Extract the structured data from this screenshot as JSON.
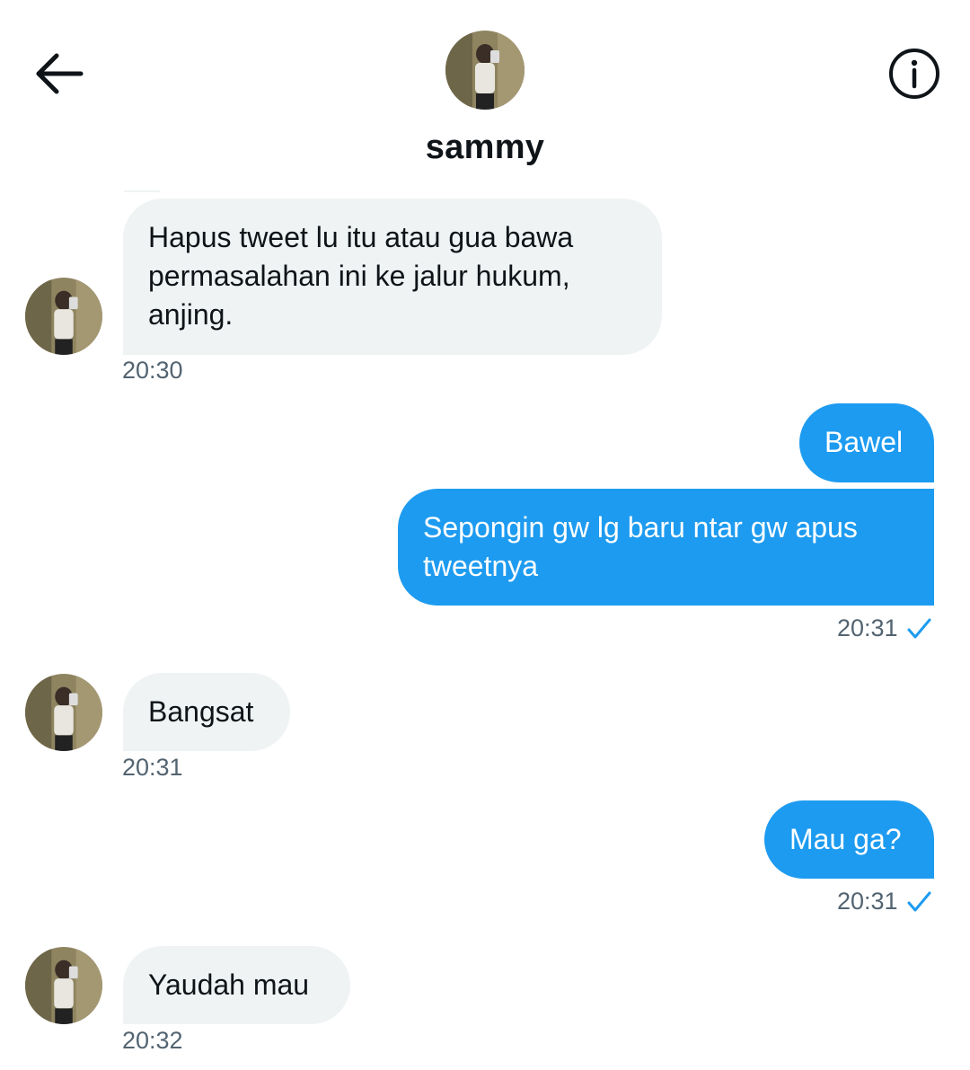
{
  "header": {
    "title": "sammy",
    "back_icon": "arrow-left-icon",
    "info_icon": "info-icon"
  },
  "messages": [
    {
      "direction": "incoming",
      "text": "Hapus tweet lu itu atau gua bawa permasalahan ini ke jalur hukum, anjing.",
      "lines": [
        "Hapus tweet lu itu atau gua bawa",
        "permasalahan ini ke jalur hukum,",
        "anjing."
      ],
      "time": "20:30"
    },
    {
      "direction": "outgoing",
      "text": "Bawel"
    },
    {
      "direction": "outgoing",
      "text": "Sepongin gw lg baru ntar gw apus tweetnya",
      "lines": [
        "Sepongin gw lg baru ntar gw apus",
        "tweetnya"
      ],
      "time": "20:31",
      "status": "sent"
    },
    {
      "direction": "incoming",
      "text": "Bangsat",
      "time": "20:31"
    },
    {
      "direction": "outgoing",
      "text": "Mau ga?",
      "time": "20:31",
      "status": "sent"
    },
    {
      "direction": "incoming",
      "text": "Yaudah mau",
      "time": "20:32"
    }
  ],
  "colors": {
    "outgoing_bubble": "#1d9bf0",
    "incoming_bubble": "#eff3f4",
    "timestamp": "#536471",
    "check": "#1d9bf0"
  }
}
